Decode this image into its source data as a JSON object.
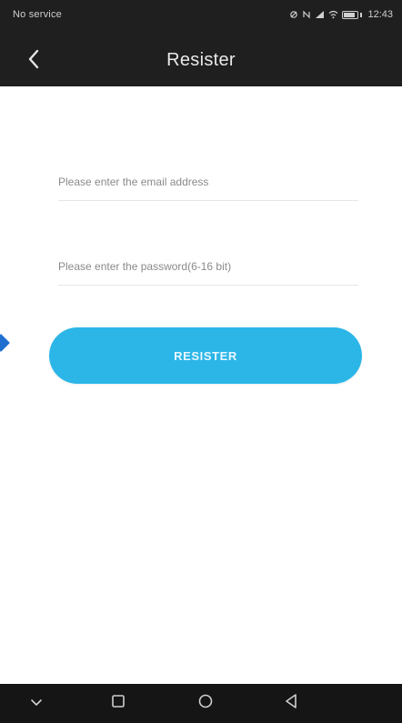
{
  "status_bar": {
    "left_text": "No service",
    "right_text": "12:43",
    "icons": [
      "mute-icon",
      "nfc-icon",
      "signal-icon",
      "wifi-icon",
      "battery-icon"
    ]
  },
  "header": {
    "title": "Resister",
    "back_icon": "chevron-left-icon"
  },
  "form": {
    "email_placeholder": "Please enter the email address",
    "password_placeholder": "Please enter the password(6-16 bit)",
    "register_label": "RESISTER"
  },
  "nav_bar": {
    "icons": [
      "chevron-down-icon",
      "recent-apps-icon",
      "home-icon",
      "back-triangle-icon"
    ]
  },
  "colors": {
    "header_bg": "#1f1f1f",
    "button_bg": "#2cb6e8",
    "nav_bg": "#151515"
  }
}
